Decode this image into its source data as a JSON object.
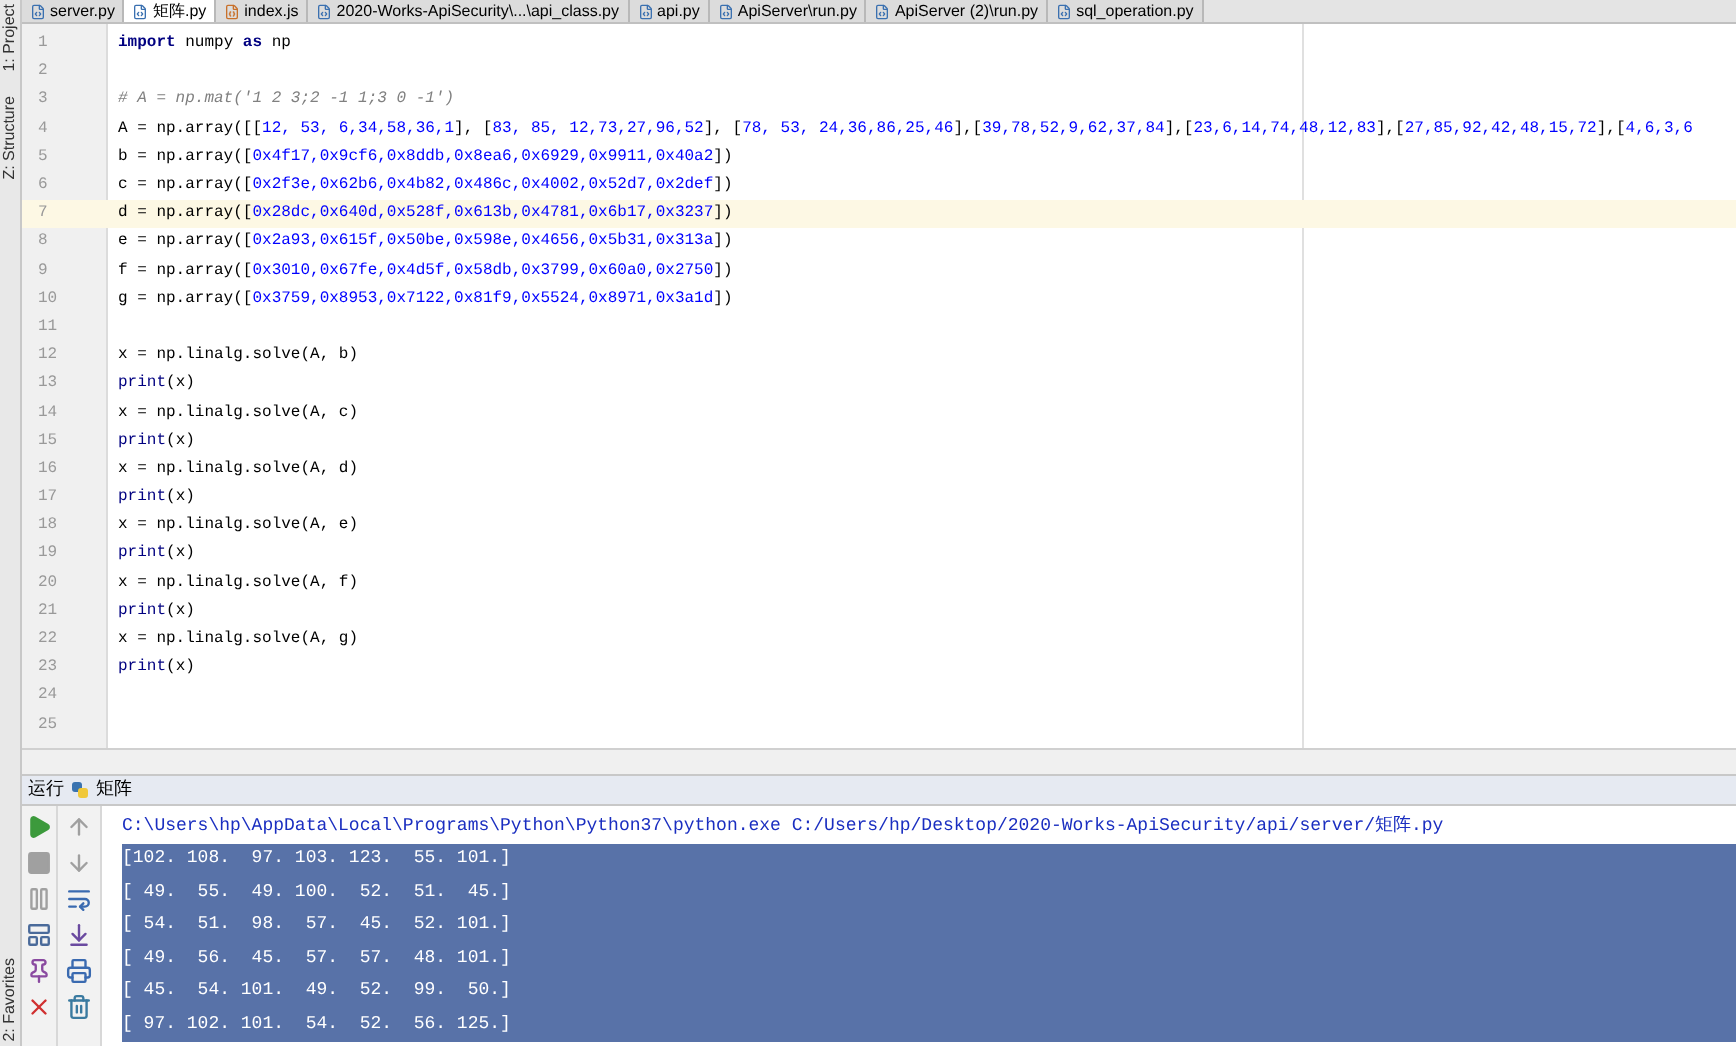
{
  "side_strip": {
    "top": [
      "1: Project",
      "Z: Structure"
    ],
    "bottom": [
      "2: Favorites"
    ]
  },
  "tabs": [
    {
      "label": "server.py",
      "selected": false,
      "kind": "python"
    },
    {
      "label": "矩阵.py",
      "selected": true,
      "kind": "python"
    },
    {
      "label": "index.js",
      "selected": false,
      "kind": "js"
    },
    {
      "label": "2020-Works-ApiSecurity\\...\\api_class.py",
      "selected": false,
      "kind": "python"
    },
    {
      "label": "api.py",
      "selected": false,
      "kind": "python"
    },
    {
      "label": "ApiServer\\run.py",
      "selected": false,
      "kind": "python"
    },
    {
      "label": "ApiServer (2)\\run.py",
      "selected": false,
      "kind": "python"
    },
    {
      "label": "sql_operation.py",
      "selected": false,
      "kind": "python"
    }
  ],
  "editor": {
    "lines": [
      {
        "number": "1",
        "current": false,
        "segments": [
          {
            "kind": "keyword",
            "text": "import"
          },
          {
            "kind": "plain",
            "text": " numpy "
          },
          {
            "kind": "keyword",
            "text": "as"
          },
          {
            "kind": "plain",
            "text": " np"
          }
        ]
      },
      {
        "number": "2",
        "current": false
      },
      {
        "number": "3",
        "current": false,
        "segments": [
          {
            "kind": "comment",
            "text": "# A = np.mat('1 2 3;2 -1 1;3 0 -1')"
          }
        ]
      },
      {
        "number": "4",
        "current": false,
        "segments": [
          {
            "kind": "plain",
            "text": "A = np.array([["
          },
          {
            "kind": "number",
            "text": "12, 53, 6,34,58,36,1"
          },
          {
            "kind": "plain",
            "text": "], ["
          },
          {
            "kind": "number",
            "text": "83, 85, 12,73,27,96,52"
          },
          {
            "kind": "plain",
            "text": "], ["
          },
          {
            "kind": "number",
            "text": "78, 53, 24,36,86,25,46"
          },
          {
            "kind": "plain",
            "text": "],["
          },
          {
            "kind": "number",
            "text": "39,78,52,9,62,37,84"
          },
          {
            "kind": "plain",
            "text": "],["
          },
          {
            "kind": "number",
            "text": "23,6,14,74,48,12,83"
          },
          {
            "kind": "plain",
            "text": "],["
          },
          {
            "kind": "number",
            "text": "27,85,92,42,48,15,72"
          },
          {
            "kind": "plain",
            "text": "],["
          },
          {
            "kind": "number",
            "text": "4,6,3,6"
          }
        ]
      },
      {
        "number": "5",
        "current": false,
        "segments": [
          {
            "kind": "plain",
            "text": "b = np.array(["
          },
          {
            "kind": "number",
            "text": "0x4f17,0x9cf6,0x8ddb,0x8ea6,0x6929,0x9911,0x40a2"
          },
          {
            "kind": "plain",
            "text": "])"
          }
        ]
      },
      {
        "number": "6",
        "current": false,
        "segments": [
          {
            "kind": "plain",
            "text": "c = np.array(["
          },
          {
            "kind": "number",
            "text": "0x2f3e,0x62b6,0x4b82,0x486c,0x4002,0x52d7,0x2def"
          },
          {
            "kind": "plain",
            "text": "])"
          }
        ]
      },
      {
        "number": "7",
        "current": true,
        "segments": [
          {
            "kind": "plain",
            "text": "d = np.array(["
          },
          {
            "kind": "number",
            "text": "0x28dc,0x640d,0x528f,0x613b,0x4781,0x6b17,0x3237"
          },
          {
            "kind": "plain",
            "text": "])"
          }
        ]
      },
      {
        "number": "8",
        "current": false,
        "segments": [
          {
            "kind": "plain",
            "text": "e = np.array(["
          },
          {
            "kind": "number",
            "text": "0x2a93,0x615f,0x50be,0x598e,0x4656,0x5b31,0x313a"
          },
          {
            "kind": "plain",
            "text": "])"
          }
        ]
      },
      {
        "number": "9",
        "current": false,
        "segments": [
          {
            "kind": "plain",
            "text": "f = np.array(["
          },
          {
            "kind": "number",
            "text": "0x3010,0x67fe,0x4d5f,0x58db,0x3799,0x60a0,0x2750"
          },
          {
            "kind": "plain",
            "text": "])"
          }
        ]
      },
      {
        "number": "10",
        "current": false,
        "segments": [
          {
            "kind": "plain",
            "text": "g = np.array(["
          },
          {
            "kind": "number",
            "text": "0x3759,0x8953,0x7122,0x81f9,0x5524,0x8971,0x3a1d"
          },
          {
            "kind": "plain",
            "text": "])"
          }
        ]
      },
      {
        "number": "11",
        "current": false
      },
      {
        "number": "12",
        "current": false,
        "segments": [
          {
            "kind": "plain",
            "text": "x = np.linalg.solve(A, b)"
          }
        ]
      },
      {
        "number": "13",
        "current": false,
        "segments": [
          {
            "kind": "builtin",
            "text": "print"
          },
          {
            "kind": "plain",
            "text": "(x)"
          }
        ]
      },
      {
        "number": "14",
        "current": false,
        "segments": [
          {
            "kind": "plain",
            "text": "x = np.linalg.solve(A, c)"
          }
        ]
      },
      {
        "number": "15",
        "current": false,
        "segments": [
          {
            "kind": "builtin",
            "text": "print"
          },
          {
            "kind": "plain",
            "text": "(x)"
          }
        ]
      },
      {
        "number": "16",
        "current": false,
        "segments": [
          {
            "kind": "plain",
            "text": "x = np.linalg.solve(A, d)"
          }
        ]
      },
      {
        "number": "17",
        "current": false,
        "segments": [
          {
            "kind": "builtin",
            "text": "print"
          },
          {
            "kind": "plain",
            "text": "(x)"
          }
        ]
      },
      {
        "number": "18",
        "current": false,
        "segments": [
          {
            "kind": "plain",
            "text": "x = np.linalg.solve(A, e)"
          }
        ]
      },
      {
        "number": "19",
        "current": false,
        "segments": [
          {
            "kind": "builtin",
            "text": "print"
          },
          {
            "kind": "plain",
            "text": "(x)"
          }
        ]
      },
      {
        "number": "20",
        "current": false,
        "segments": [
          {
            "kind": "plain",
            "text": "x = np.linalg.solve(A, f)"
          }
        ]
      },
      {
        "number": "21",
        "current": false,
        "segments": [
          {
            "kind": "builtin",
            "text": "print"
          },
          {
            "kind": "plain",
            "text": "(x)"
          }
        ]
      },
      {
        "number": "22",
        "current": false,
        "segments": [
          {
            "kind": "plain",
            "text": "x = np.linalg.solve(A, g)"
          }
        ]
      },
      {
        "number": "23",
        "current": false,
        "segments": [
          {
            "kind": "builtin",
            "text": "print"
          },
          {
            "kind": "plain",
            "text": "(x)"
          }
        ]
      },
      {
        "number": "24",
        "current": false
      },
      {
        "number": "25",
        "current": false
      }
    ]
  },
  "run_panel": {
    "title": "运行",
    "config": "矩阵",
    "tools_left": [
      {
        "kind": "run"
      },
      {
        "kind": "stop"
      },
      {
        "kind": "pause"
      },
      {
        "kind": "layout"
      },
      {
        "kind": "pin"
      },
      {
        "kind": "close"
      }
    ],
    "tools_right": [
      {
        "kind": "up"
      },
      {
        "kind": "down"
      },
      {
        "kind": "wrap"
      },
      {
        "kind": "scroll-end"
      },
      {
        "kind": "print"
      },
      {
        "kind": "trash"
      }
    ],
    "output": [
      {
        "text": "C:\\Users\\hp\\AppData\\Local\\Programs\\Python\\Python37\\python.exe C:/Users/hp/Desktop/2020-Works-ApiSecurity/api/server/矩阵.py",
        "selected": false,
        "kind": "command"
      },
      {
        "text": "[102. 108.  97. 103. 123.  55. 101.]",
        "selected": true,
        "kind": "output"
      },
      {
        "text": "[ 49.  55.  49. 100.  52.  51.  45.]",
        "selected": true,
        "kind": "output"
      },
      {
        "text": "[ 54.  51.  98.  57.  45.  52. 101.]",
        "selected": true,
        "kind": "output"
      },
      {
        "text": "[ 49.  56.  45.  57.  57.  48. 101.]",
        "selected": true,
        "kind": "output"
      },
      {
        "text": "[ 45.  54. 101.  49.  52.  99.  50.]",
        "selected": true,
        "kind": "output"
      },
      {
        "text": "[ 97. 102. 101.  54.  52.  56. 125.]",
        "selected": true,
        "kind": "output"
      }
    ]
  }
}
